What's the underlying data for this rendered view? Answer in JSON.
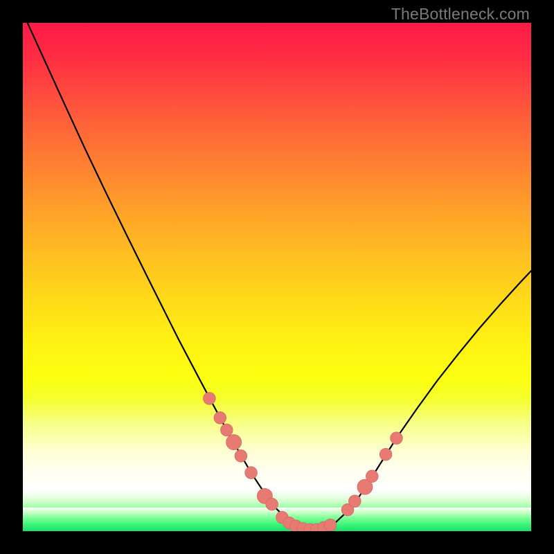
{
  "watermark": "TheBottleneck.com",
  "colors": {
    "frame": "#000000",
    "curve": "#000000",
    "marker_fill": "#e77a72",
    "marker_stroke": "#d46a63",
    "gradient_top": "#ff1a47",
    "gradient_bottom": "#1be069"
  },
  "chart_data": {
    "type": "line",
    "title": "",
    "xlabel": "",
    "ylabel": "",
    "xlim": [
      0,
      100
    ],
    "ylim": [
      0,
      100
    ],
    "grid": false,
    "legend": false,
    "series": [
      {
        "name": "curve",
        "x": [
          0,
          4.1,
          8.2,
          12.2,
          16.3,
          20.4,
          24.5,
          28.6,
          30.6,
          34.7,
          38.8,
          40.8,
          44.9,
          49.0,
          53.1,
          57.1,
          61.2,
          65.0,
          69.4,
          73.5,
          77.6,
          81.6,
          85.7,
          89.8,
          93.9,
          98.0,
          100.0
        ],
        "y": [
          102.0,
          93.0,
          84.0,
          75.3,
          66.7,
          58.3,
          50.0,
          41.8,
          37.8,
          30.0,
          22.3,
          18.6,
          11.5,
          5.3,
          1.2,
          0.0,
          1.4,
          5.0,
          11.8,
          18.3,
          24.2,
          29.7,
          34.9,
          39.9,
          44.6,
          49.1,
          51.2
        ]
      }
    ],
    "markers": [
      {
        "x": 36.7,
        "y": 26.1,
        "r": 1.2
      },
      {
        "x": 38.8,
        "y": 22.3,
        "r": 1.2
      },
      {
        "x": 40.1,
        "y": 19.9,
        "r": 1.2
      },
      {
        "x": 41.5,
        "y": 17.5,
        "r": 1.5
      },
      {
        "x": 42.9,
        "y": 14.8,
        "r": 1.2
      },
      {
        "x": 44.9,
        "y": 11.5,
        "r": 1.2
      },
      {
        "x": 47.6,
        "y": 6.9,
        "r": 1.5
      },
      {
        "x": 49.0,
        "y": 5.3,
        "r": 1.2
      },
      {
        "x": 51.0,
        "y": 2.7,
        "r": 1.2
      },
      {
        "x": 52.4,
        "y": 1.6,
        "r": 1.2
      },
      {
        "x": 53.7,
        "y": 1.0,
        "r": 1.2
      },
      {
        "x": 55.1,
        "y": 0.5,
        "r": 1.2
      },
      {
        "x": 56.5,
        "y": 0.3,
        "r": 1.2
      },
      {
        "x": 57.8,
        "y": 0.3,
        "r": 1.2
      },
      {
        "x": 59.2,
        "y": 0.7,
        "r": 1.2
      },
      {
        "x": 60.5,
        "y": 1.2,
        "r": 1.2
      },
      {
        "x": 63.9,
        "y": 4.2,
        "r": 1.2
      },
      {
        "x": 65.3,
        "y": 5.9,
        "r": 1.2
      },
      {
        "x": 67.3,
        "y": 8.7,
        "r": 1.5
      },
      {
        "x": 68.7,
        "y": 10.8,
        "r": 1.2
      },
      {
        "x": 71.4,
        "y": 15.1,
        "r": 1.2
      },
      {
        "x": 73.5,
        "y": 18.3,
        "r": 1.2
      }
    ]
  }
}
